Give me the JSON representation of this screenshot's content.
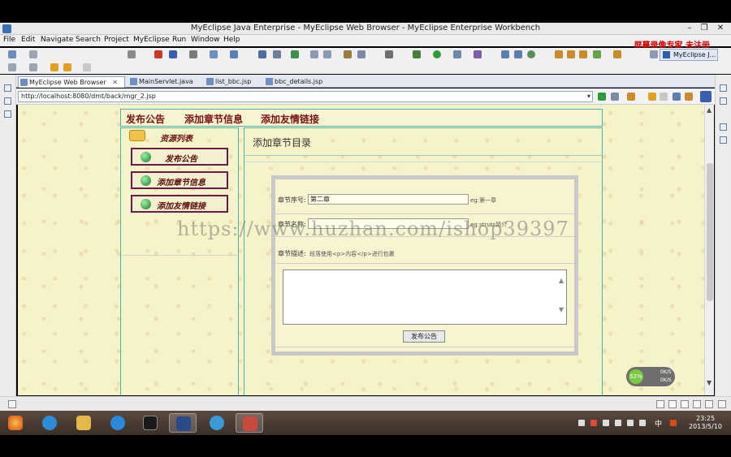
{
  "window": {
    "title": "MyEclipse Java Enterprise - MyEclipse Web Browser - MyEclipse Enterprise Workbench",
    "controls": [
      "–",
      "❐",
      "✕"
    ]
  },
  "menu": [
    "File",
    "Edit",
    "Navigate",
    "Search",
    "Project",
    "MyEclipse",
    "Run",
    "Window",
    "Help"
  ],
  "recorder_watermark": "屏幕录像专家 未注册",
  "perspective": "MyEclipse J...",
  "tabs": [
    {
      "label": "MyEclipse Web Browser",
      "active": true,
      "close": "✕"
    },
    {
      "label": "MainServlet.java",
      "active": false
    },
    {
      "label": "list_bbc.jsp",
      "active": false
    },
    {
      "label": "bbc_details.jsp",
      "active": false
    }
  ],
  "browser": {
    "url": "http://localhost:8080/dmt/back/mgr_2.jsp",
    "dropdown": "▾"
  },
  "page": {
    "nav": [
      "发布公告",
      "添加章节信息",
      "添加友情链接"
    ],
    "resources_title": "资源列表",
    "side_buttons": [
      "发布公告",
      "添加章节信息",
      "添加友情链接"
    ],
    "main_title": "添加章节目录",
    "form": {
      "seq_label": "章节序号:",
      "seq_value": "第二章",
      "seq_note": "eg:第一章",
      "name_label": "章节名称:",
      "name_value": "",
      "name_note": "eg:struts简介",
      "desc_label": "章节描述:",
      "desc_note": "段落使用<p>内容</p>进行包裹",
      "submit": "发布公告"
    }
  },
  "overlay_watermark": "https://www.huzhan.com/ishop39397",
  "net_widget": {
    "percent": "52%",
    "up": "0K/S",
    "down": "0K/S"
  },
  "tray": {
    "time": "23:25",
    "date": "2013/5/10",
    "ime": "中"
  }
}
